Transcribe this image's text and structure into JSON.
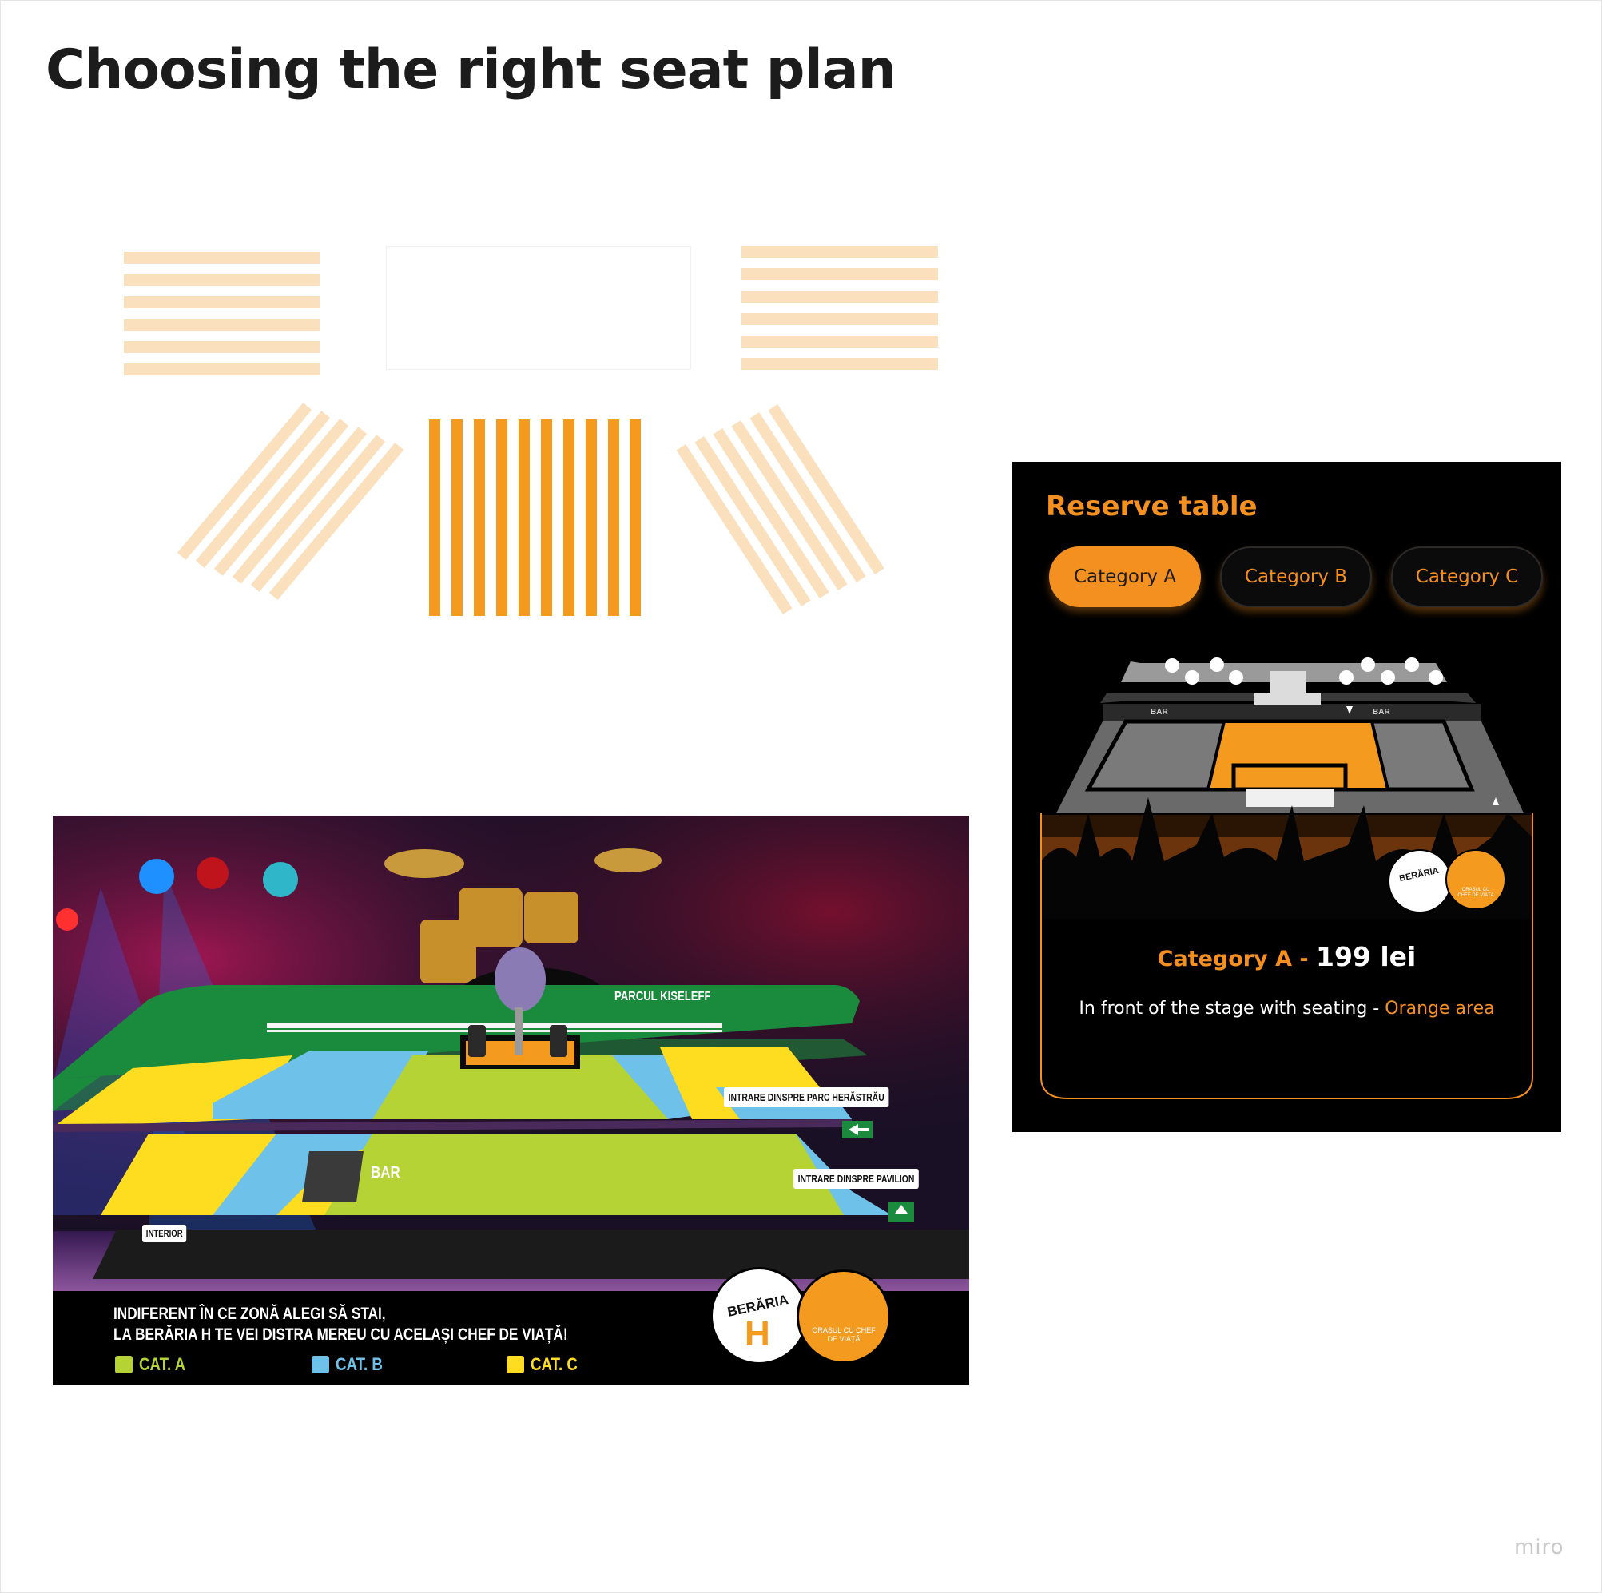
{
  "page": {
    "title": "Choosing the right seat plan",
    "watermark": "miro"
  },
  "concert_map": {
    "labels": {
      "park": "PARCUL KISELEFF",
      "entrance_park": "INTRARE DINSPRE PARC HERĂSTRĂU",
      "entrance_pavilion": "INTRARE DINSPRE PAVILION",
      "bar": "BAR",
      "interior": "INTERIOR"
    },
    "slogan_line1": "INDIFERENT ÎN CE ZONĂ ALEGI SĂ STAI,",
    "slogan_line2": "LA BERĂRIA H TE VEI DISTRA MEREU CU ACELAȘI CHEF DE VIAȚĂ!",
    "legend": [
      {
        "label": "CAT. A",
        "color": "#b5d334"
      },
      {
        "label": "CAT. B",
        "color": "#6ec1e9"
      },
      {
        "label": "CAT. C",
        "color": "#fedc1f"
      }
    ],
    "logos": {
      "beraria": "BERĂRIA",
      "beraria_letter": "H",
      "city": "ORAȘUL CU CHEF DE VIAȚĂ"
    }
  },
  "reserve_panel": {
    "title": "Reserve table",
    "categories": [
      {
        "label": "Category A",
        "active": true
      },
      {
        "label": "Category B",
        "active": false
      },
      {
        "label": "Category C",
        "active": false
      }
    ],
    "mini_map_labels": {
      "bar_left": "BAR",
      "bar_right": "BAR"
    },
    "selected_category": "Category A",
    "price_separator": " - ",
    "price": "199 lei",
    "description": "In front of the stage with seating",
    "description_separator": " - ",
    "area": "Orange area",
    "logos": {
      "beraria": "BERĂRIA",
      "city": "ORAȘUL CU CHEF DE VIAȚĂ"
    }
  },
  "colors": {
    "accent": "#f4901f",
    "light_accent": "#fbe0bd",
    "cat_a": "#b5d334",
    "cat_b": "#6ec1e9",
    "cat_c": "#fedc1f",
    "grass": "#1a8a3c"
  }
}
